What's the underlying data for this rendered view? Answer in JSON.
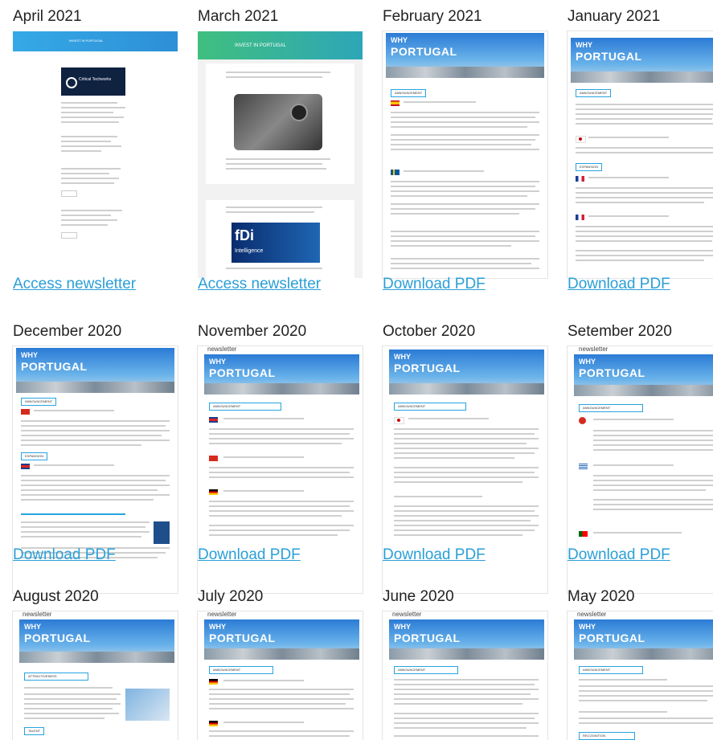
{
  "newsletters": [
    {
      "month": "April 2021",
      "link": "Access newsletter",
      "style": "web-blue"
    },
    {
      "month": "March 2021",
      "link": "Access newsletter",
      "style": "web-green"
    },
    {
      "month": "February 2021",
      "link": "Download PDF",
      "style": "pdf"
    },
    {
      "month": "January 2021",
      "link": "Download PDF",
      "style": "pdf"
    },
    {
      "month": "December 2020",
      "link": "Download PDF",
      "style": "pdf"
    },
    {
      "month": "November 2020",
      "link": "Download PDF",
      "style": "pdf"
    },
    {
      "month": "October 2020",
      "link": "Download PDF",
      "style": "pdf"
    },
    {
      "month": "Setember 2020",
      "link": "Download PDF",
      "style": "pdf"
    },
    {
      "month": "August 2020",
      "link": "",
      "style": "pdf"
    },
    {
      "month": "July 2020",
      "link": "",
      "style": "pdf"
    },
    {
      "month": "June 2020",
      "link": "",
      "style": "pdf"
    },
    {
      "month": "May 2020",
      "link": "",
      "style": "pdf"
    }
  ],
  "thumb_text": {
    "newsletter_word": "newsletter",
    "why": "WHY",
    "portugal": "PORTUGAL",
    "march_banner": "INVEST IN PORTUGAL",
    "april_banner": "INVEST IN PORTUGAL",
    "critical": "Critical Techworks",
    "fdi": "fDi",
    "fdi_sub": "Intelligence",
    "announcement": "ANNOUNCEMENT",
    "attractiveness": "ATTRACTIVENESS",
    "expansion": "EXPANSION",
    "talent": "TALENT",
    "recognition": "RECOGNITION"
  },
  "colors": {
    "link": "#2a9fd8",
    "accent": "#27a3e0"
  }
}
